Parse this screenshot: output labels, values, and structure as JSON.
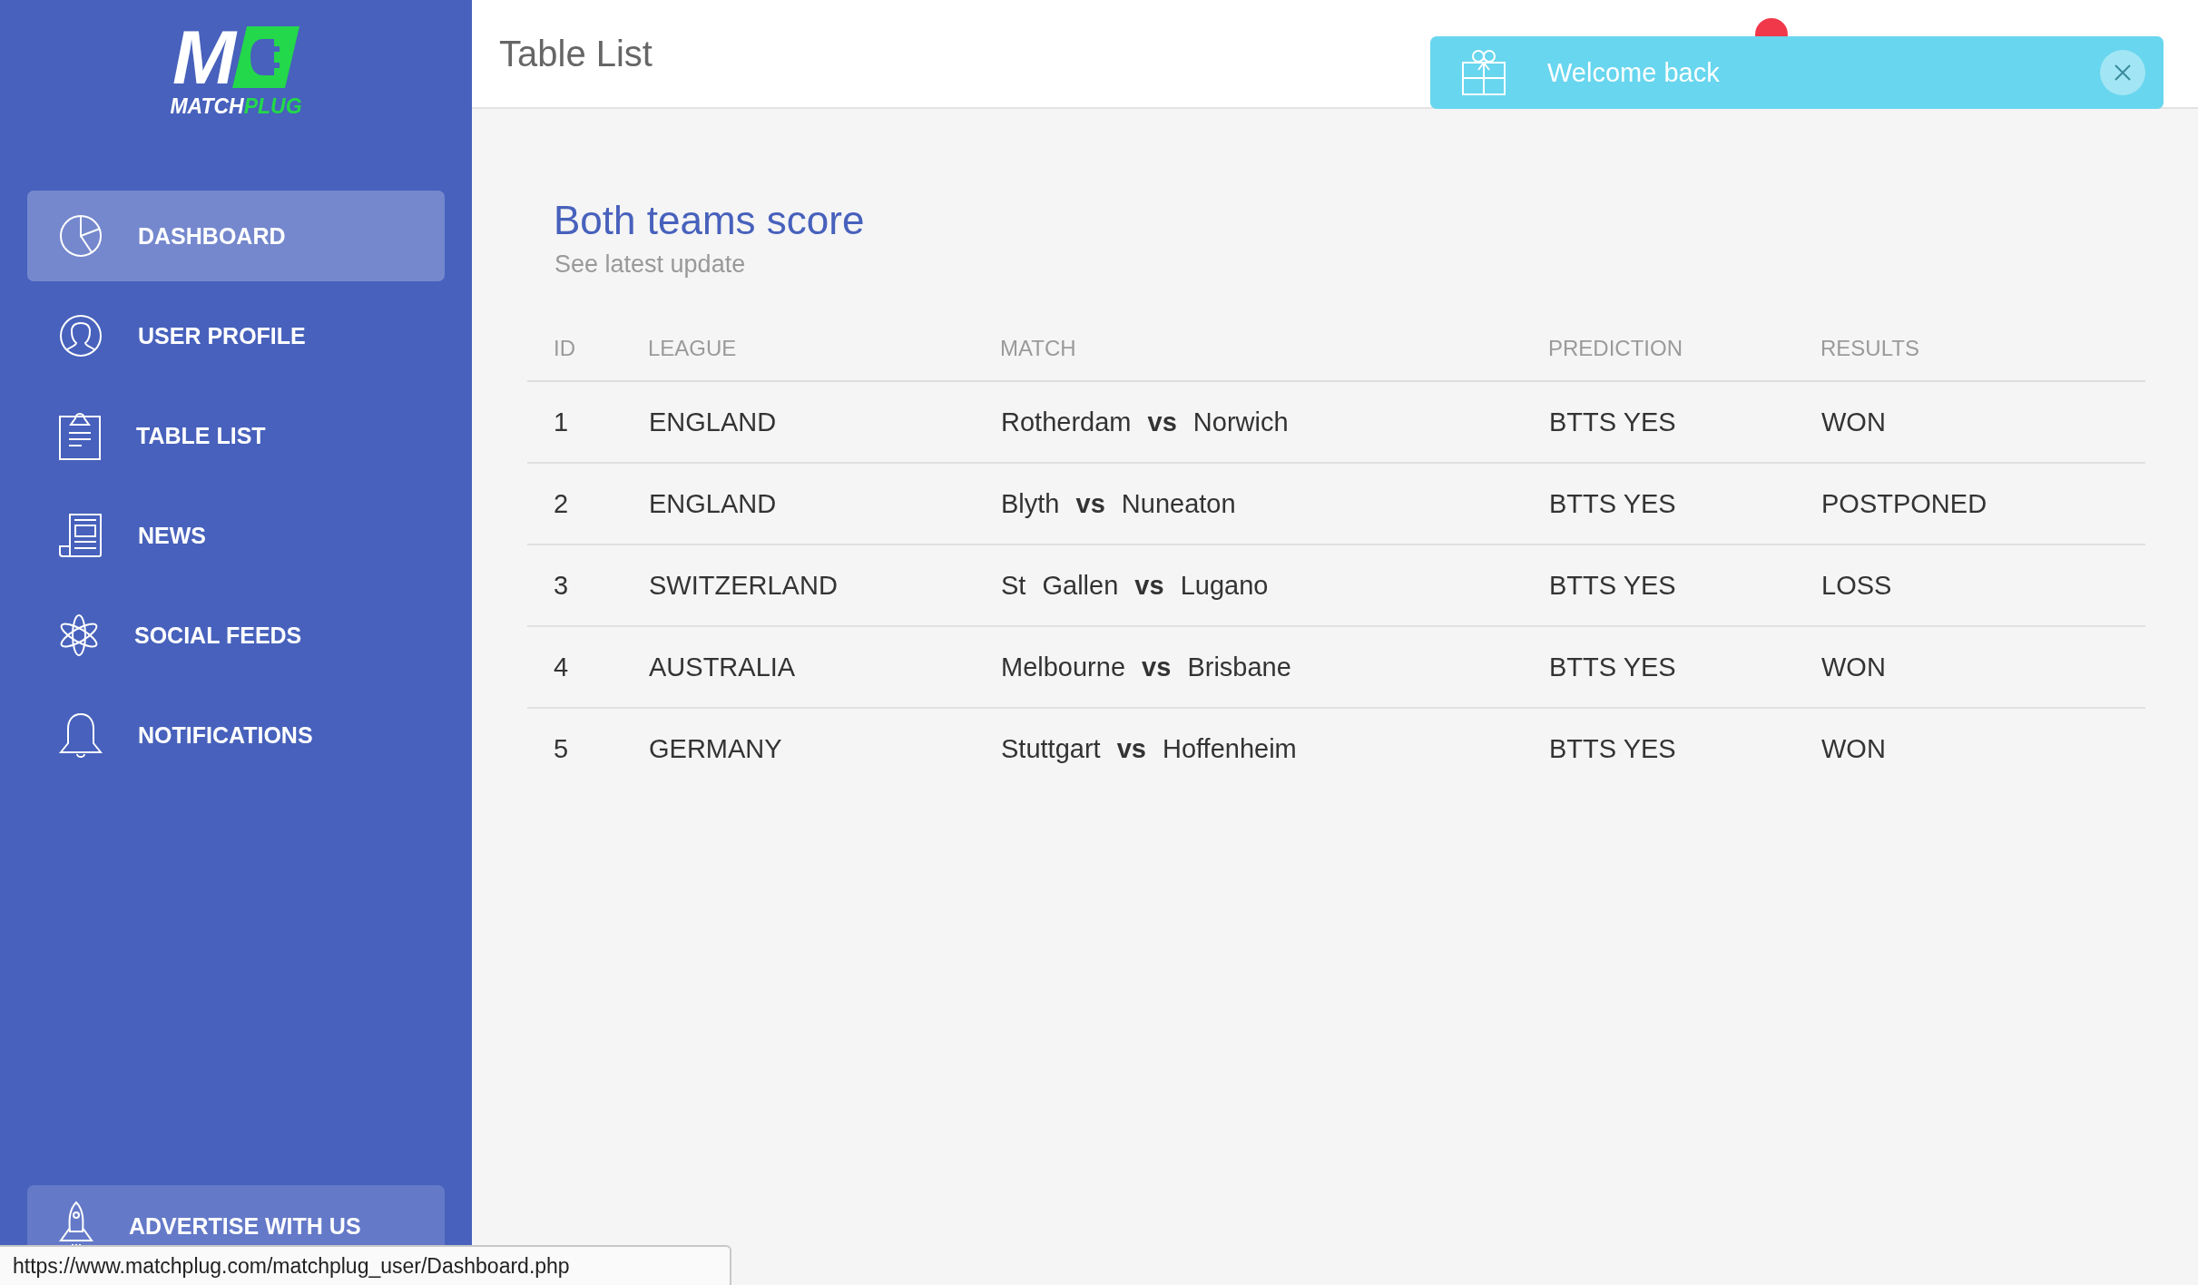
{
  "logo": {
    "mark": "M",
    "word_1": "MATCH",
    "word_2": "PLUG"
  },
  "sidebar": {
    "items": [
      {
        "label": "DASHBOARD",
        "selected": true
      },
      {
        "label": "USER PROFILE",
        "selected": false
      },
      {
        "label": "TABLE LIST",
        "selected": false
      },
      {
        "label": "NEWS",
        "selected": false
      },
      {
        "label": "SOCIAL FEEDS",
        "selected": false
      },
      {
        "label": "NOTIFICATIONS",
        "selected": false
      }
    ],
    "footer_button": {
      "label": "ADVERTISE WITH US"
    }
  },
  "header": {
    "title": "Table List"
  },
  "toast": {
    "message": "Welcome back"
  },
  "card": {
    "title": "Both teams score",
    "subtitle": "See latest update"
  },
  "table": {
    "columns": [
      "ID",
      "LEAGUE",
      "MATCH",
      "PREDICTION",
      "RESULTS"
    ],
    "rows": [
      [
        "1",
        "ENGLAND",
        "Rotherdam **vs** Norwich",
        "BTTS YES",
        "WON"
      ],
      [
        "2",
        "ENGLAND",
        "Blyth **vs** Nuneaton",
        "BTTS YES",
        "POSTPONED"
      ],
      [
        "3",
        "SWITZERLAND",
        "St Gallen **vs** Lugano",
        "BTTS YES",
        "LOSS"
      ],
      [
        "4",
        "AUSTRALIA",
        "Melbourne **vs** Brisbane",
        "BTTS YES",
        "WON"
      ],
      [
        "5",
        "GERMANY",
        "Stuttgart **vs** Hoffenheim",
        "BTTS YES",
        "WON"
      ]
    ]
  },
  "status_bar": {
    "url": "https://www.matchplug.com/matchplug_user/Dashboard.php"
  }
}
